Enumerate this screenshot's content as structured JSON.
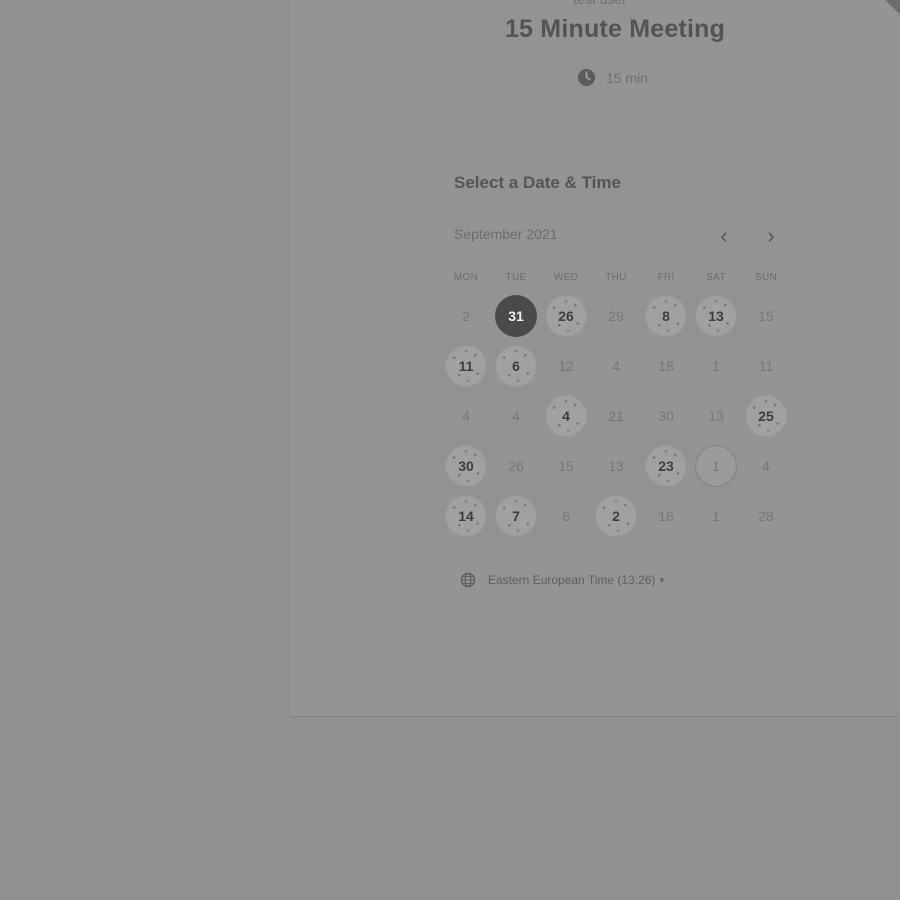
{
  "organizer": "test user",
  "event": {
    "title": "15 Minute Meeting",
    "duration": "15 min",
    "duration_icon": "clock-icon"
  },
  "picker": {
    "title": "Select a Date & Time",
    "month": "September 2021",
    "prev_label": "‹",
    "next_label": "›",
    "weekdays": [
      "MON",
      "TUE",
      "WED",
      "THU",
      "FRI",
      "SAT",
      "SUN"
    ],
    "weeks": [
      [
        {
          "label": "2",
          "state": "unavailable"
        },
        {
          "label": "31",
          "state": "selected"
        },
        {
          "label": "26",
          "state": "available"
        },
        {
          "label": "29",
          "state": "unavailable"
        },
        {
          "label": "8",
          "state": "available"
        },
        {
          "label": "13",
          "state": "available"
        },
        {
          "label": "15",
          "state": "unavailable"
        }
      ],
      [
        {
          "label": "11",
          "state": "available"
        },
        {
          "label": "6",
          "state": "available"
        },
        {
          "label": "12",
          "state": "unavailable"
        },
        {
          "label": "4",
          "state": "unavailable"
        },
        {
          "label": "18",
          "state": "unavailable"
        },
        {
          "label": "1",
          "state": "unavailable"
        },
        {
          "label": "11",
          "state": "unavailable"
        }
      ],
      [
        {
          "label": "4",
          "state": "unavailable"
        },
        {
          "label": "4",
          "state": "unavailable"
        },
        {
          "label": "4",
          "state": "available"
        },
        {
          "label": "21",
          "state": "unavailable"
        },
        {
          "label": "30",
          "state": "unavailable"
        },
        {
          "label": "13",
          "state": "unavailable"
        },
        {
          "label": "25",
          "state": "available"
        }
      ],
      [
        {
          "label": "30",
          "state": "available"
        },
        {
          "label": "26",
          "state": "unavailable"
        },
        {
          "label": "15",
          "state": "unavailable"
        },
        {
          "label": "13",
          "state": "unavailable"
        },
        {
          "label": "23",
          "state": "available"
        },
        {
          "label": "1",
          "state": "outlined"
        },
        {
          "label": "4",
          "state": "unavailable"
        }
      ],
      [
        {
          "label": "14",
          "state": "available"
        },
        {
          "label": "7",
          "state": "available"
        },
        {
          "label": "6",
          "state": "unavailable"
        },
        {
          "label": "2",
          "state": "available"
        },
        {
          "label": "16",
          "state": "unavailable"
        },
        {
          "label": "1",
          "state": "unavailable"
        },
        {
          "label": "28",
          "state": "unavailable"
        }
      ]
    ]
  },
  "timezone": {
    "label": "Eastern European Time (13:26)",
    "icon": "globe-icon",
    "caret": "▾"
  },
  "colors": {
    "background": "#8f8f8f",
    "selected_day": "#4a4a4a",
    "available_day": "#a1a1a1"
  }
}
